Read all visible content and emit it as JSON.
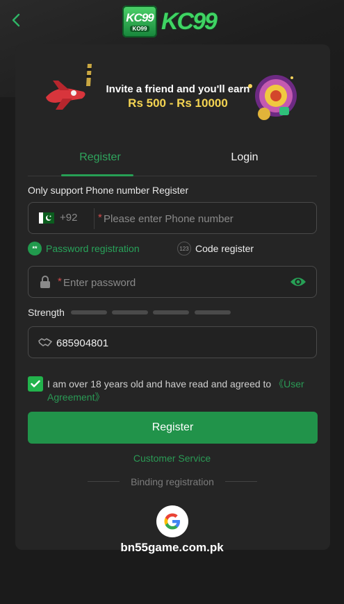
{
  "brand": {
    "logo_badge_big": "KC99",
    "logo_badge_small": "KO99",
    "logo_text": "KC99"
  },
  "banner": {
    "line1": "Invite a friend and you'll earn",
    "line2": "Rs 500 - Rs 10000"
  },
  "tabs": {
    "register": "Register",
    "login": "Login",
    "active": "register"
  },
  "form": {
    "support_label": "Only support Phone number Register",
    "phone": {
      "country_code": "+92",
      "required_mark": "*",
      "placeholder": "Please enter Phone number",
      "value": ""
    },
    "modes": {
      "password_label": "Password registration",
      "code_icon": "123",
      "code_label": "Code register",
      "selected": "password"
    },
    "password": {
      "required_mark": "*",
      "placeholder": "Enter password",
      "value": ""
    },
    "strength": {
      "label": "Strength",
      "level": 0,
      "segments": 4
    },
    "invite_code": {
      "value": "685904801"
    },
    "agreement": {
      "checked": true,
      "text": "I am over 18 years old and have read and agreed to ",
      "link": "《User Agreement》"
    },
    "register_button": "Register"
  },
  "customer_service": "Customer Service",
  "binding_label": "Binding registration",
  "watermark": "bn55game.com.pk",
  "icons": [
    "back-arrow-icon",
    "pakistan-flag-icon",
    "lock-icon",
    "eye-icon",
    "handshake-icon",
    "check-icon",
    "google-icon"
  ],
  "colors": {
    "accent": "#27a055",
    "background": "#1b1b1b",
    "card": "#252525",
    "required": "#d24b4b"
  }
}
